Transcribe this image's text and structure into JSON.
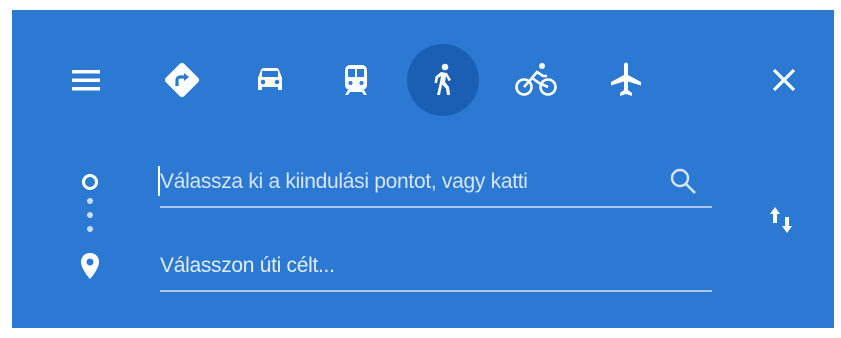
{
  "colors": {
    "panel_background": "#2b79d2",
    "active_mode_background": "#1a5fb4",
    "icon_color": "#ffffff"
  },
  "modes": [
    {
      "name": "best-route",
      "icon": "diamond-turn-arrow-icon",
      "active": false
    },
    {
      "name": "driving",
      "icon": "car-icon",
      "active": false
    },
    {
      "name": "transit",
      "icon": "train-icon",
      "active": false
    },
    {
      "name": "walking",
      "icon": "walking-person-icon",
      "active": true
    },
    {
      "name": "cycling",
      "icon": "bicycle-icon",
      "active": false
    },
    {
      "name": "flights",
      "icon": "airplane-icon",
      "active": false
    }
  ],
  "route": {
    "origin": {
      "placeholder": "Válassza ki a kiindulási pontot, vagy katti"
    },
    "destination": {
      "placeholder": "Válasszon úti célt..."
    }
  }
}
